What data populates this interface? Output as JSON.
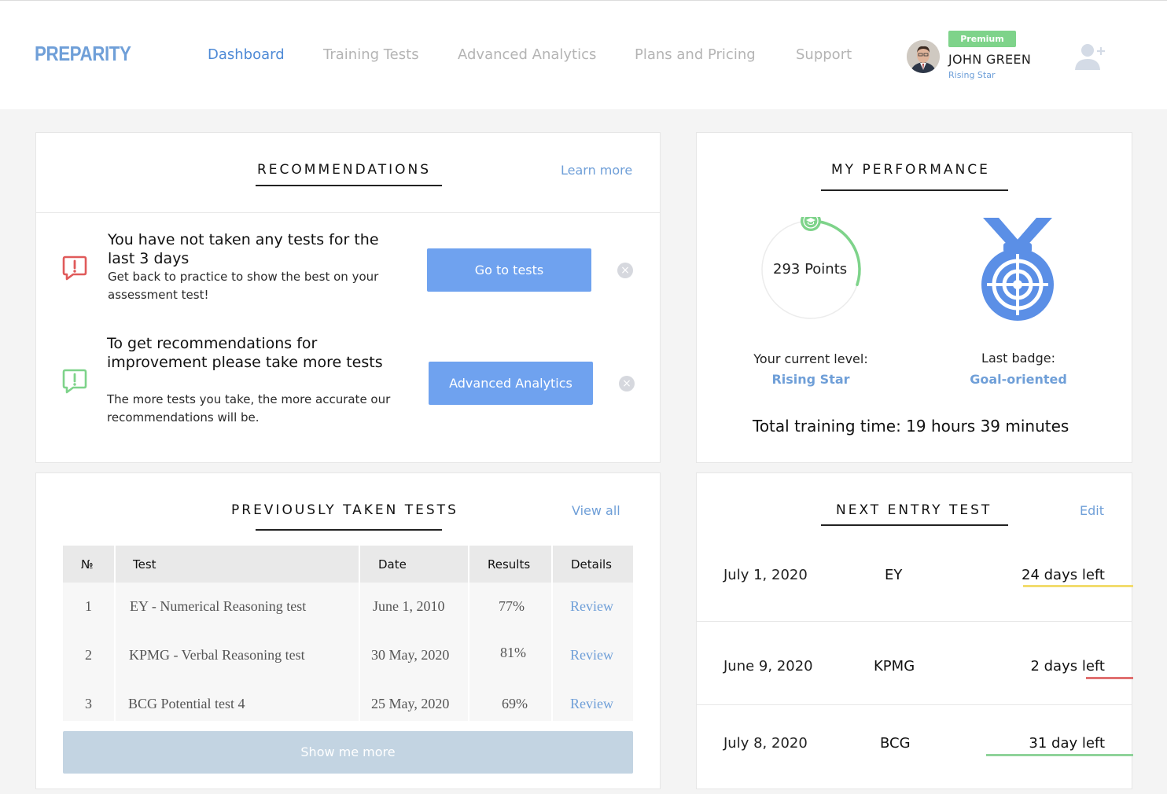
{
  "header": {
    "logo": "PREPARITY",
    "nav": [
      {
        "label": "Dashboard",
        "active": true
      },
      {
        "label": "Training Tests",
        "active": false
      },
      {
        "label": "Advanced Analytics",
        "active": false
      },
      {
        "label": "Plans and Pricing",
        "active": false
      },
      {
        "label": "Support",
        "active": false
      }
    ],
    "user": {
      "badge": "Premium",
      "name": "JOHN GREEN",
      "level": "Rising Star"
    }
  },
  "recommendations": {
    "title": "RECOMMENDATIONS",
    "learn_more": "Learn more",
    "items": [
      {
        "title": "You have not taken any tests for the last 3 days",
        "description": "Get back to practice to show the best on your assessment test!",
        "button": "Go to tests",
        "icon": "alert-icon",
        "icon_color": "#e05a5a"
      },
      {
        "title": "To get recommendations for improvement please take more tests",
        "description": "The more tests you take, the more accurate our recommendations will be.",
        "button": "Advanced Analytics",
        "icon": "alert-icon",
        "icon_color": "#7ed38a"
      }
    ]
  },
  "performance": {
    "title": "MY PERFORMANCE",
    "points": "293 Points",
    "points_progress": 0.3,
    "level_label": "Your current level:",
    "level_value": "Rising Star",
    "badge_label": "Last badge:",
    "badge_value": "Goal-oriented",
    "total": "Total training time: 19 hours 39 minutes"
  },
  "previous_tests": {
    "title": "PREVIOUSLY TAKEN TESTS",
    "view_all": "View all",
    "columns": [
      "№",
      "Test",
      "Date",
      "Results",
      "Details"
    ],
    "rows": [
      {
        "num": "1",
        "test": "EY - Numerical Reasoning test",
        "date": "June 1, 2010",
        "result": "77%",
        "details": "Review"
      },
      {
        "num": "2",
        "test": "KPMG - Verbal Reasoning test",
        "date": "30 May, 2020",
        "result": "81%",
        "details": "Review"
      },
      {
        "num": "3",
        "test": "BCG Potential test 4",
        "date": "25 May, 2020",
        "result": "69%",
        "details": "Review"
      }
    ],
    "show_more": "Show me more"
  },
  "next_entry": {
    "title": "NEXT ENTRY TEST",
    "edit": "Edit",
    "rows": [
      {
        "date": "July 1,  2020",
        "company": "EY",
        "days": "24 days left",
        "color": "#f2dc6e"
      },
      {
        "date": "June 9,  2020",
        "company": "KPMG",
        "days": "2 days left",
        "color": "#e07070"
      },
      {
        "date": "July 8,  2020",
        "company": "BCG",
        "days": "31 day left",
        "color": "#8fd39a"
      }
    ]
  },
  "colors": {
    "accent": "#6f9fd8",
    "button": "#6fa2ef",
    "premium": "#7ed38a"
  }
}
